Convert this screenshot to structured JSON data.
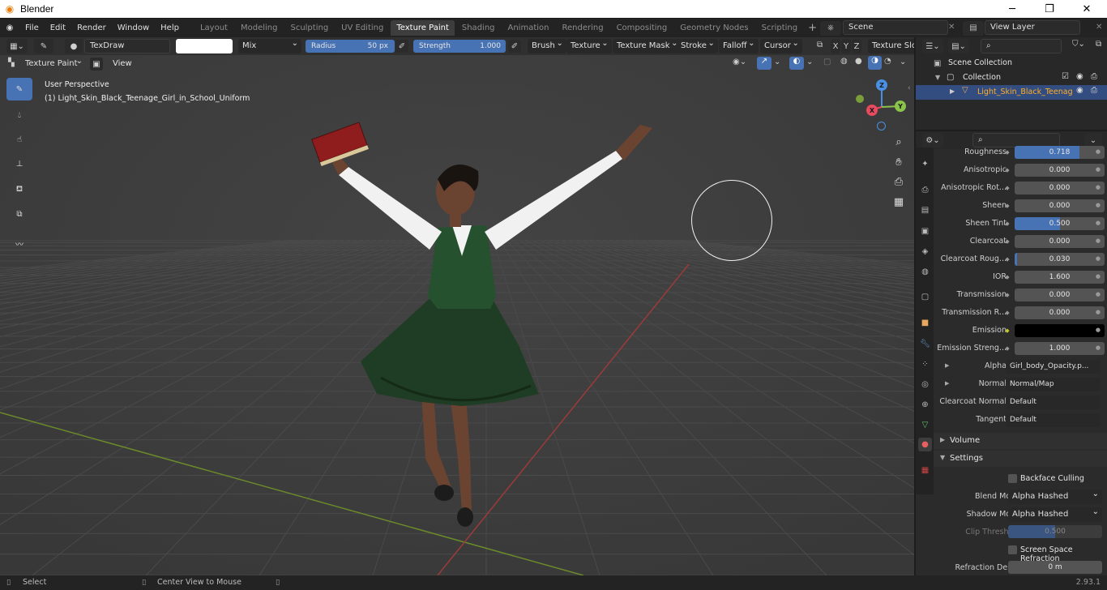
{
  "app": {
    "title": "Blender",
    "version": "2.93.1"
  },
  "menu": [
    "File",
    "Edit",
    "Render",
    "Window",
    "Help"
  ],
  "workspaces": [
    "Layout",
    "Modeling",
    "Sculpting",
    "UV Editing",
    "Texture Paint",
    "Shading",
    "Animation",
    "Rendering",
    "Compositing",
    "Geometry Nodes",
    "Scripting"
  ],
  "active_workspace": "Texture Paint",
  "scene": "Scene",
  "view_layer": "View Layer",
  "tool_header": {
    "brush_name": "TexDraw",
    "blend": "Mix",
    "radius_label": "Radius",
    "radius_value": "50 px",
    "strength_label": "Strength",
    "strength_value": "1.000",
    "menus": [
      "Brush",
      "Texture",
      "Texture Mask",
      "Stroke",
      "Falloff",
      "Cursor"
    ],
    "axes": [
      "X",
      "Y",
      "Z"
    ],
    "texture_slots": "Texture Slots"
  },
  "viewport": {
    "mode": "Texture Paint",
    "view_menu": "View",
    "perspective": "User Perspective",
    "object_label": "(1) Light_Skin_Black_Teenage_Girl_in_School_Uniform",
    "gizmo": {
      "x": "X",
      "y": "Y",
      "z": "Z"
    }
  },
  "outliner": {
    "scene_collection": "Scene Collection",
    "collection": "Collection",
    "object": "Light_Skin_Black_Teenag"
  },
  "properties": {
    "rows": [
      {
        "label": "Roughness",
        "value": "0.718",
        "fill": 0.718
      },
      {
        "label": "Anisotropic",
        "value": "0.000",
        "fill": 0
      },
      {
        "label": "Anisotropic Rot...",
        "value": "0.000",
        "fill": 0
      },
      {
        "label": "Sheen",
        "value": "0.000",
        "fill": 0
      },
      {
        "label": "Sheen Tint",
        "value": "0.500",
        "fill": 0.5
      },
      {
        "label": "Clearcoat",
        "value": "0.000",
        "fill": 0
      },
      {
        "label": "Clearcoat Roug...",
        "value": "0.030",
        "fill": 0.03
      },
      {
        "label": "IOR",
        "value": "1.600",
        "fill": 0
      },
      {
        "label": "Transmission",
        "value": "0.000",
        "fill": 0
      },
      {
        "label": "Transmission R...",
        "value": "0.000",
        "fill": 0
      },
      {
        "label": "Emission",
        "value": "",
        "fill": 0
      },
      {
        "label": "Emission Streng...",
        "value": "1.000",
        "fill": 0
      },
      {
        "label": "Alpha",
        "value": "Girl_body_Opacity.p...",
        "fill": 0
      },
      {
        "label": "Normal",
        "value": "Normal/Map",
        "fill": 0
      },
      {
        "label": "Clearcoat Normal",
        "value": "Default",
        "fill": 0
      },
      {
        "label": "Tangent",
        "value": "Default",
        "fill": 0
      }
    ],
    "volume": "Volume",
    "settings": "Settings",
    "backface_culling": "Backface Culling",
    "blend_mode_label": "Blend Mode",
    "blend_mode": "Alpha Hashed",
    "shadow_mode_label": "Shadow Mode",
    "shadow_mode": "Alpha Hashed",
    "clip_threshold_label": "Clip Threshold",
    "clip_threshold": "0.500",
    "screen_space_refraction": "Screen Space Refraction",
    "refraction_depth_label": "Refraction Depth",
    "refraction_depth": "0 m"
  },
  "status": {
    "select": "Select",
    "center": "Center View to Mouse"
  },
  "colors": {
    "accent": "#4772b3",
    "emission_dot": "#c7c729",
    "axis_x": "#e84a5f",
    "axis_y": "#8bc34a",
    "axis_z": "#4a90e2"
  }
}
